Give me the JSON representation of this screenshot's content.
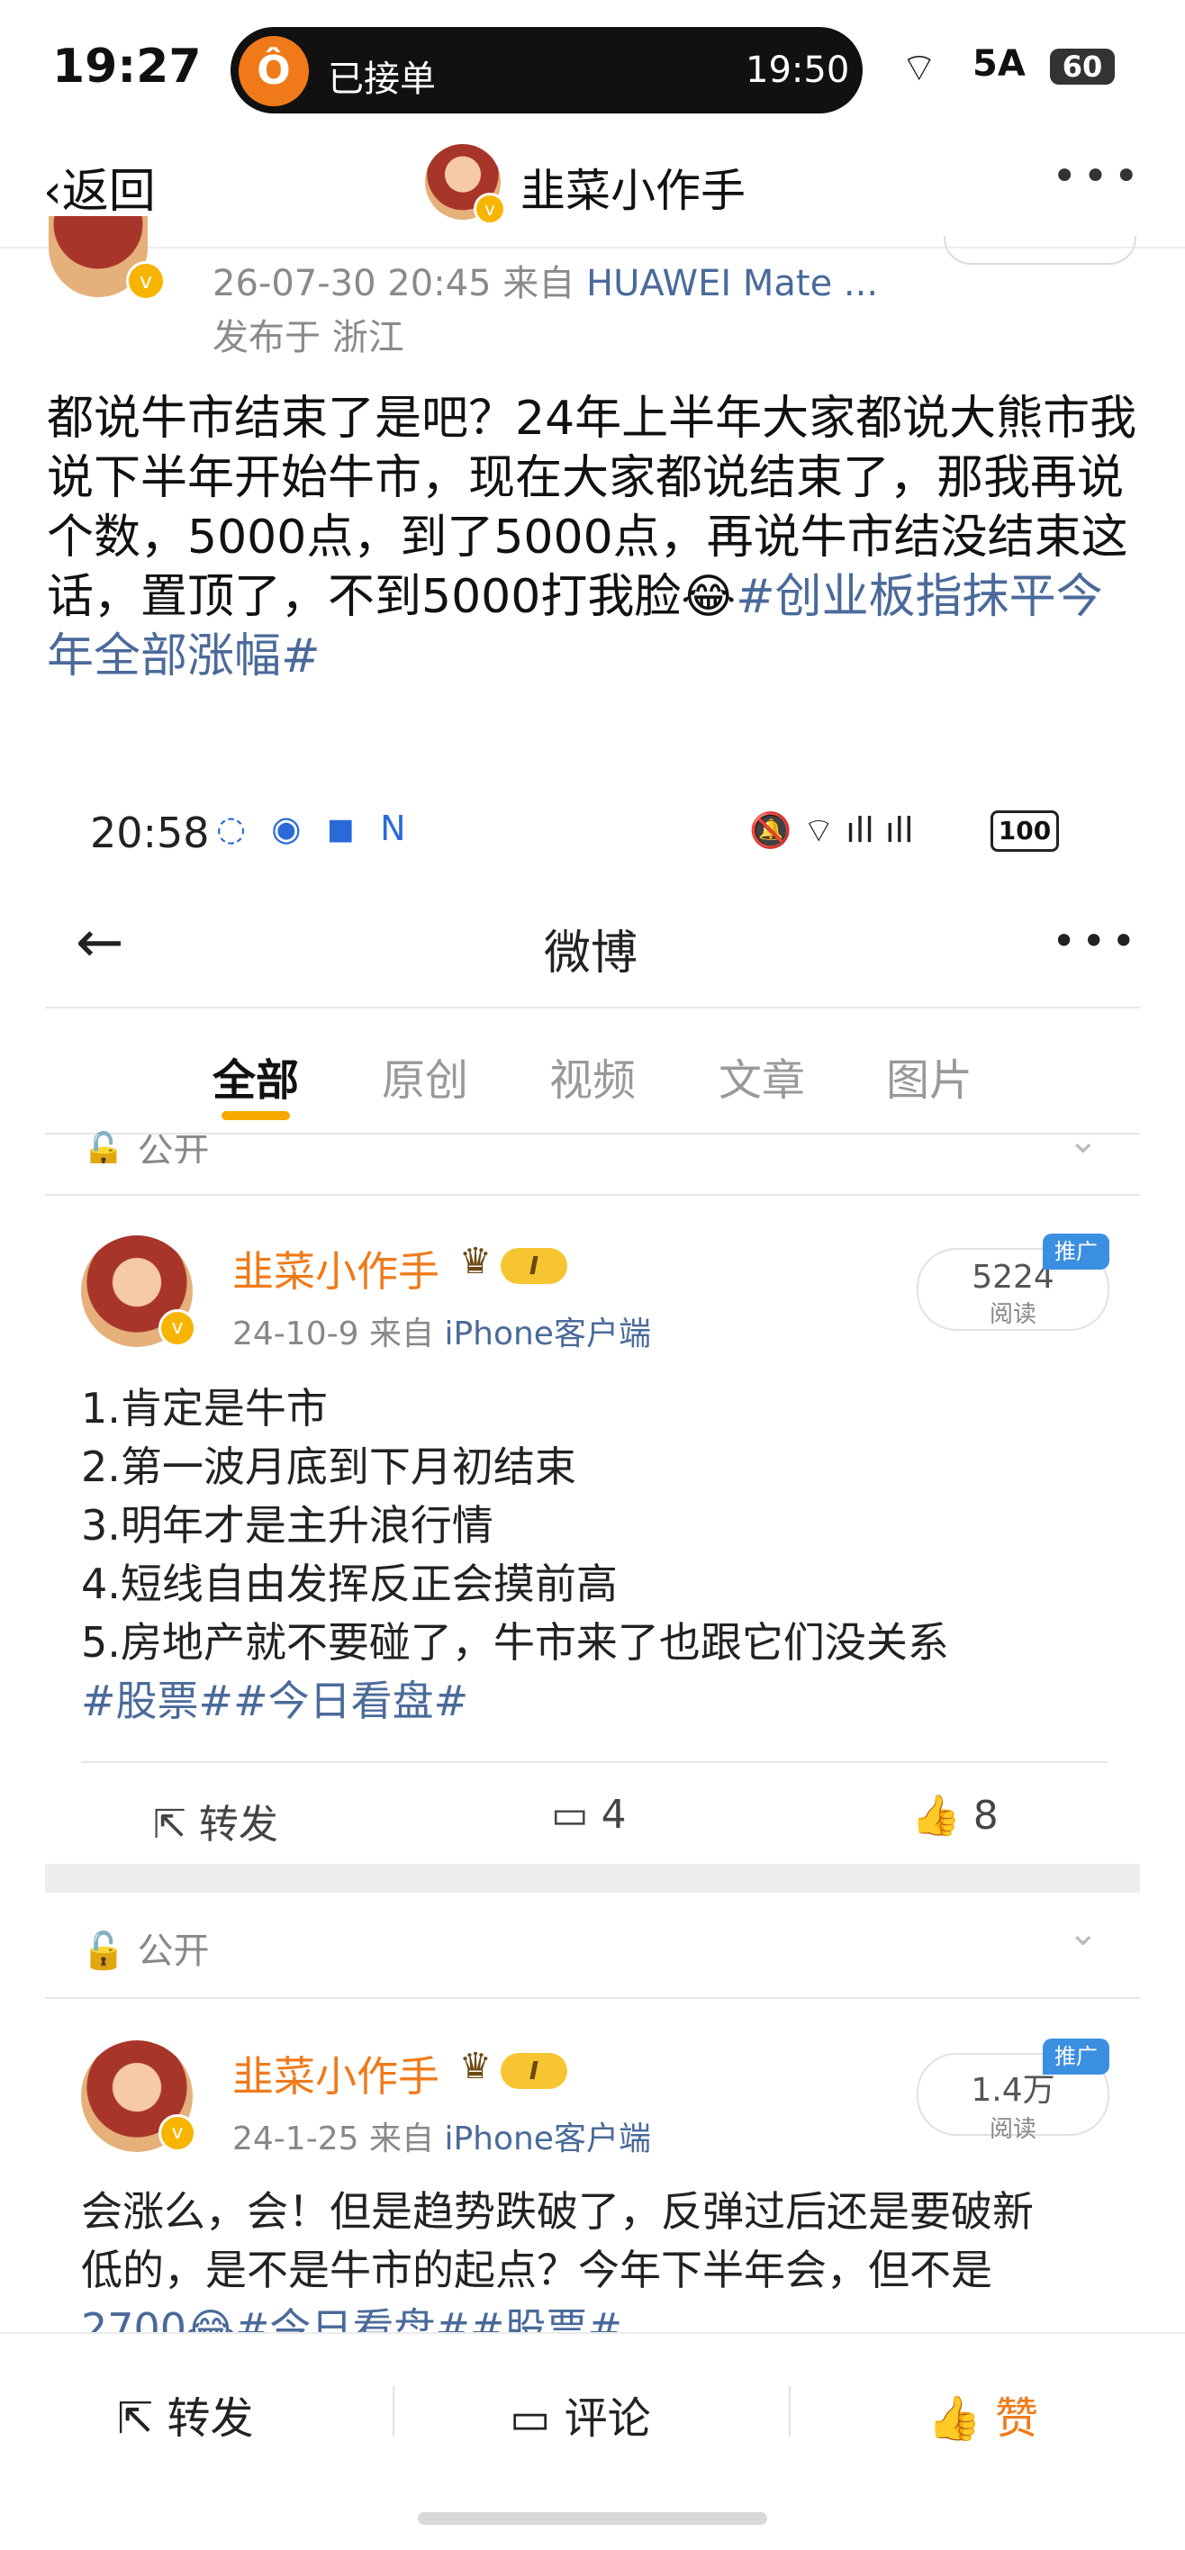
{
  "status": {
    "time": "19:27",
    "pill_text": "已接单",
    "pill_time": "19:50",
    "signal": "5A",
    "battery": "60"
  },
  "nav": {
    "back_label": "返回",
    "title": "韭菜小作手"
  },
  "post": {
    "meta_date": "26-07-30 20:45",
    "meta_from": "来自",
    "meta_source": "HUAWEI Mate ...",
    "location": "发布于 浙江",
    "text": "都说牛市结束了是吧？24年上半年大家都说大熊市我说下半年开始牛市，现在大家都说结束了，那我再说个数，5000点，到了5000点，再说牛市结没结束这话，置顶了，不到5000打我脸😂",
    "tag": "#创业板指抹平今年全部涨幅#"
  },
  "embedded": {
    "time": "20:58",
    "battery": "100",
    "title": "微博",
    "tabs": [
      "全部",
      "原创",
      "视频",
      "文章",
      "图片"
    ],
    "public_label": "公开",
    "card1": {
      "name": "韭菜小作手",
      "date": "24-10-9",
      "from": "来自",
      "source": "iPhone客户端",
      "reads": "5224",
      "reads_label": "阅读",
      "promo": "推广",
      "lines": [
        "1.肯定是牛市",
        "2.第一波月底到下月初结束",
        "3.明年才是主升浪行情",
        "4.短线自由发挥反正会摸前高",
        "5.房地产就不要碰了，牛市来了也跟它们没关系"
      ],
      "tags": "#股票##今日看盘#",
      "repost": "转发",
      "comments": "4",
      "likes": "8"
    },
    "card2": {
      "name": "韭菜小作手",
      "date": "24-1-25",
      "from": "来自",
      "source": "iPhone客户端",
      "reads": "1.4万",
      "reads_label": "阅读",
      "promo": "推广",
      "line1": "会涨么，会！但是趋势跌破了，反弹过后还是要破新",
      "line2": "低的，是不是牛市的起点？今年下半年会，但不是",
      "line3": "2700😂#今日看盘##股票#"
    }
  },
  "bottom_bar": {
    "repost": "转发",
    "comment": "评论",
    "like": "赞"
  }
}
